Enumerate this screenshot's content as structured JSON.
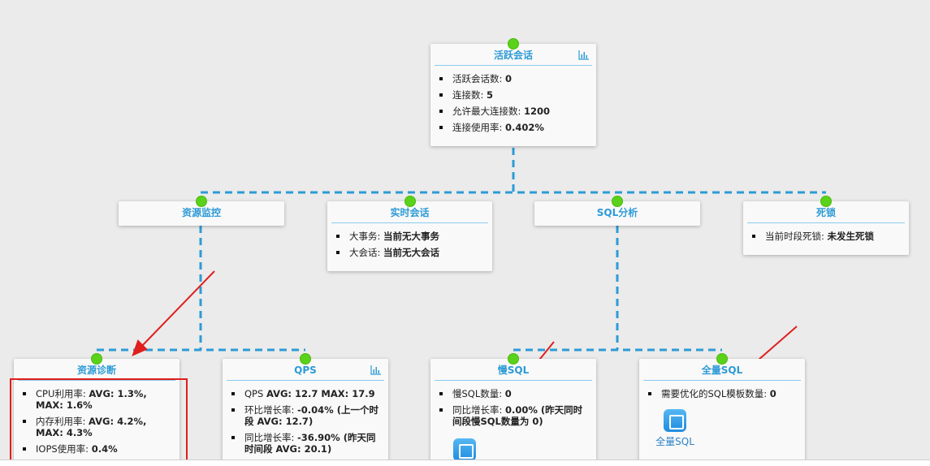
{
  "colors": {
    "connector": "#2d9bd6",
    "node_dot": "#5ad21a",
    "header_text": "#2d9bd6",
    "annotation": "#e01e1e"
  },
  "nodes": {
    "active_sessions": {
      "title": "活跃会话",
      "icon": "bar-chart-icon",
      "items": [
        {
          "label": "活跃会话数: ",
          "value": "0"
        },
        {
          "label": "连接数: ",
          "value": "5"
        },
        {
          "label": "允许最大连接数: ",
          "value": "1200"
        },
        {
          "label": "连接使用率: ",
          "value": "0.402%"
        }
      ]
    },
    "resource_monitor": {
      "title": "资源监控"
    },
    "realtime_sessions": {
      "title": "实时会话",
      "items": [
        {
          "label": "大事务: ",
          "value": "当前无大事务"
        },
        {
          "label": "大会话: ",
          "value": "当前无大会话"
        }
      ]
    },
    "sql_analysis": {
      "title": "SQL分析"
    },
    "deadlock": {
      "title": "死锁",
      "items": [
        {
          "label": "当前时段死锁: ",
          "value": "未发生死锁"
        }
      ]
    },
    "resource_diagnosis": {
      "title": "资源诊断",
      "items": [
        {
          "label": "CPU利用率: ",
          "value": "AVG: 1.3%, MAX: 1.6%"
        },
        {
          "label": "内存利用率: ",
          "value": "AVG: 4.2%, MAX: 4.3%"
        },
        {
          "label": "IOPS使用率: ",
          "value": "0.4%"
        }
      ]
    },
    "qps": {
      "title": "QPS",
      "icon": "bar-chart-icon",
      "items": [
        {
          "label": "QPS ",
          "value": "AVG: 12.7 MAX: 17.9"
        },
        {
          "label": "环比增长率: ",
          "value": "-0.04% (上一个时段 AVG: 12.7)"
        },
        {
          "label": "同比增长率: ",
          "value": "-36.90% (昨天同时间段 AVG: 20.1)"
        }
      ]
    },
    "slow_sql": {
      "title": "慢SQL",
      "items": [
        {
          "label": "慢SQL数量: ",
          "value": "0"
        },
        {
          "label": "同比增长率: ",
          "value": "0.00% (昨天同时间段慢SQL数量为 0)"
        }
      ]
    },
    "full_sql": {
      "title": "全量SQL",
      "items": [
        {
          "label": "需要优化的SQL模板数量: ",
          "value": "0"
        }
      ],
      "link_label": "全量SQL"
    }
  }
}
